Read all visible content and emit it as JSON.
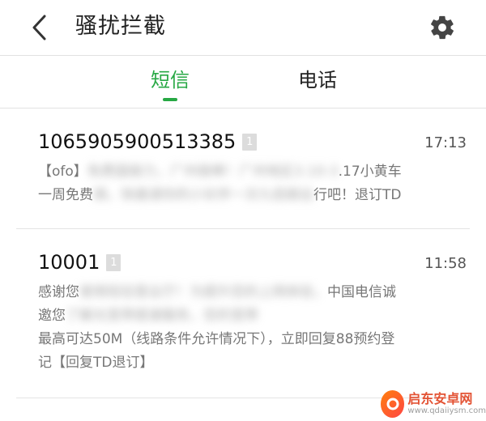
{
  "header": {
    "title": "骚扰拦截"
  },
  "tabs": [
    {
      "label": "短信",
      "active": true
    },
    {
      "label": "电话",
      "active": false
    }
  ],
  "messages": [
    {
      "sender": "1065905900513385",
      "sim": "1",
      "time": "17:13",
      "line1_clear_a": "【ofo】",
      "line1_blurred": "免费国接力，广州接棒！广州地区3.10-3",
      "line1_clear_b": ".17小黄车",
      "line2_clear_a": "一周免费",
      "line2_blurred": "骑，快邀请你的小伙伴一次九低碳出",
      "line2_clear_b": "行吧！退订TD"
    },
    {
      "sender": "10001",
      "sim": "1",
      "time": "11:58",
      "line1_clear_a": "感谢您",
      "line1_blurred": "使用短信营业厅！为提升您的上网体验，",
      "line1_clear_b": "中国电信诚",
      "line2_clear_a": "邀您",
      "line2_blurred": "了解光宽带提速服务，您的宽带",
      "line2_clear_b": "",
      "line3": "最高可达50M（线路条件允许情况下），立即回复88预约登",
      "line4": "记【回复TD退订】"
    }
  ],
  "watermark": {
    "cn": "启东安卓网",
    "en": "www.qdaiiysm.com"
  },
  "colors": {
    "accent": "#27a844",
    "divider": "#e2e2e2",
    "preview_text": "#777777"
  }
}
